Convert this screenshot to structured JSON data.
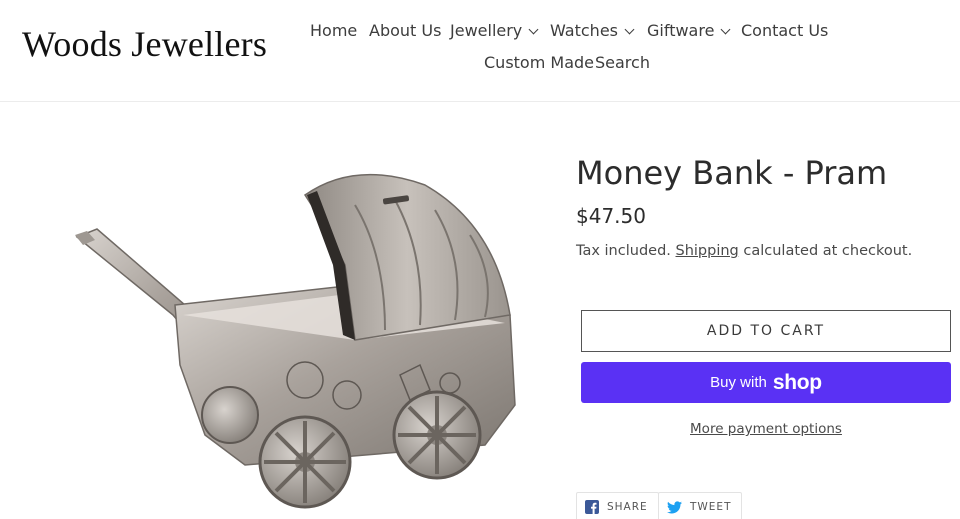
{
  "header": {
    "logo": "Woods Jewellers",
    "nav": [
      {
        "label": "Home"
      },
      {
        "label": "About Us"
      },
      {
        "label": "Jewellery"
      },
      {
        "label": "Watches"
      },
      {
        "label": "Giftware"
      },
      {
        "label": "Contact Us"
      },
      {
        "label": "Custom Made"
      },
      {
        "label": "Search"
      }
    ]
  },
  "product": {
    "title": "Money Bank - Pram",
    "price": "$47.50",
    "tax_prefix": "Tax included.",
    "shipping_link": "Shipping",
    "tax_suffix": "calculated at checkout.",
    "add_to_cart": "ADD TO CART",
    "buy_with": "Buy with",
    "shop_brand": "shop",
    "more_payment": "More payment options"
  },
  "social": {
    "share": "SHARE",
    "tweet": "TWEET"
  },
  "colors": {
    "shop_purple": "#5a31f4",
    "facebook": "#3b5998",
    "twitter": "#1da1f2"
  }
}
